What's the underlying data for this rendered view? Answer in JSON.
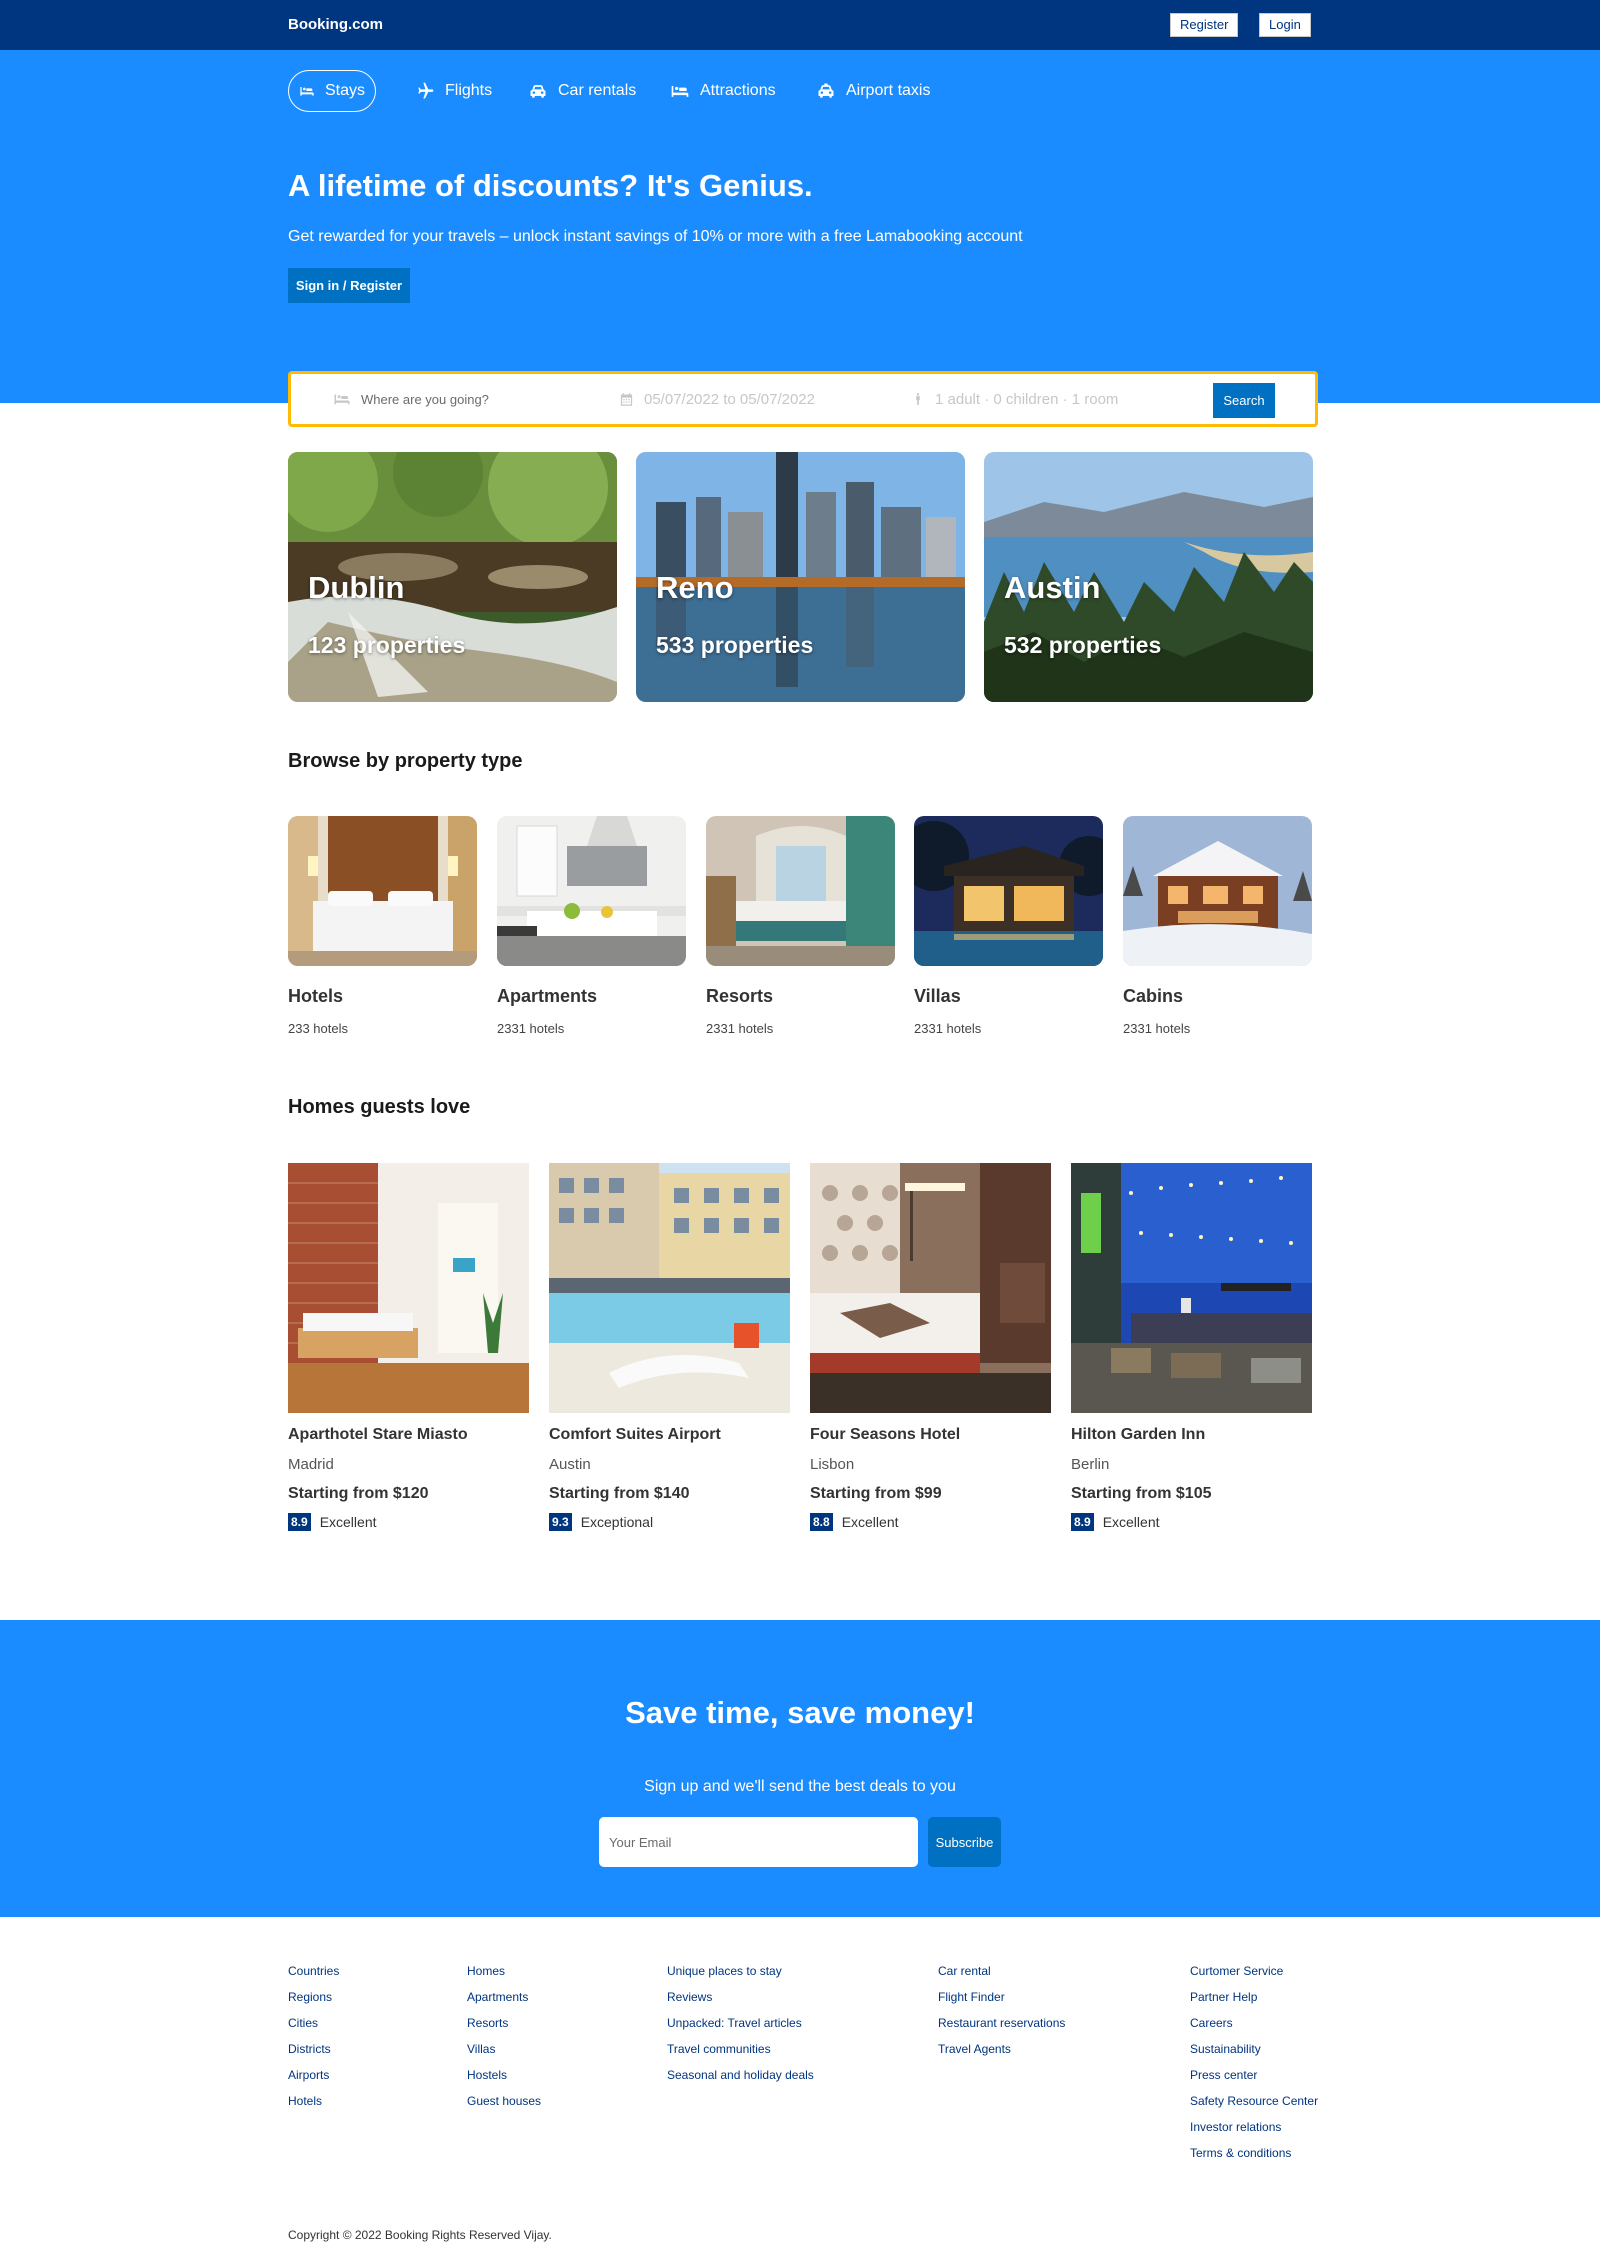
{
  "header": {
    "brand": "Booking.com",
    "register_label": "Register",
    "login_label": "Login"
  },
  "nav": {
    "items": [
      {
        "label": "Stays",
        "icon": "bed-icon"
      },
      {
        "label": "Flights",
        "icon": "plane-icon"
      },
      {
        "label": "Car rentals",
        "icon": "car-icon"
      },
      {
        "label": "Attractions",
        "icon": "bed-icon"
      },
      {
        "label": "Airport taxis",
        "icon": "taxi-icon"
      }
    ]
  },
  "hero": {
    "title": "A lifetime of discounts? It's Genius.",
    "subtitle": "Get rewarded for your travels – unlock instant savings of 10% or more with a free Lamabooking account",
    "button_label": "Sign in / Register"
  },
  "search": {
    "destination_placeholder": "Where are you going?",
    "dates": "05/07/2022 to 05/07/2022",
    "guests": "1 adult · 0 children · 1 room",
    "button_label": "Search"
  },
  "featured": [
    {
      "name": "Dublin",
      "count": "123 properties"
    },
    {
      "name": "Reno",
      "count": "533 properties"
    },
    {
      "name": "Austin",
      "count": "532 properties"
    }
  ],
  "property_types": {
    "title": "Browse by property type",
    "items": [
      {
        "name": "Hotels",
        "count": "233 hotels"
      },
      {
        "name": "Apartments",
        "count": "2331 hotels"
      },
      {
        "name": "Resorts",
        "count": "2331 hotels"
      },
      {
        "name": "Villas",
        "count": "2331 hotels"
      },
      {
        "name": "Cabins",
        "count": "2331 hotels"
      }
    ]
  },
  "homes": {
    "title": "Homes guests love",
    "items": [
      {
        "name": "Aparthotel Stare Miasto",
        "city": "Madrid",
        "price": "Starting from $120",
        "score": "8.9",
        "rating": "Excellent"
      },
      {
        "name": "Comfort Suites Airport",
        "city": "Austin",
        "price": "Starting from $140",
        "score": "9.3",
        "rating": "Exceptional"
      },
      {
        "name": "Four Seasons Hotel",
        "city": "Lisbon",
        "price": "Starting from $99",
        "score": "8.8",
        "rating": "Excellent"
      },
      {
        "name": "Hilton Garden Inn",
        "city": "Berlin",
        "price": "Starting from $105",
        "score": "8.9",
        "rating": "Excellent"
      }
    ]
  },
  "newsletter": {
    "title": "Save time, save money!",
    "subtitle": "Sign up and we'll send the best deals to you",
    "email_placeholder": "Your Email",
    "button_label": "Subscribe"
  },
  "footer": {
    "columns": [
      [
        "Countries",
        "Regions",
        "Cities",
        "Districts",
        "Airports",
        "Hotels"
      ],
      [
        "Homes",
        "Apartments",
        "Resorts",
        "Villas",
        "Hostels",
        "Guest houses"
      ],
      [
        "Unique places to stay",
        "Reviews",
        "Unpacked: Travel articles",
        "Travel communities",
        "Seasonal and holiday deals"
      ],
      [
        "Car rental",
        "Flight Finder",
        "Restaurant reservations",
        "Travel Agents"
      ],
      [
        "Curtomer Service",
        "Partner Help",
        "Careers",
        "Sustainability",
        "Press center",
        "Safety Resource Center",
        "Investor relations",
        "Terms & conditions"
      ]
    ],
    "copyright": "Copyright © 2022 Booking Rights Reserved Vijay."
  },
  "colors": {
    "topbar": "#003580",
    "hero": "#1a8cff",
    "button": "#0071c2",
    "search_border": "#febb02",
    "rating_badge": "#003580"
  }
}
